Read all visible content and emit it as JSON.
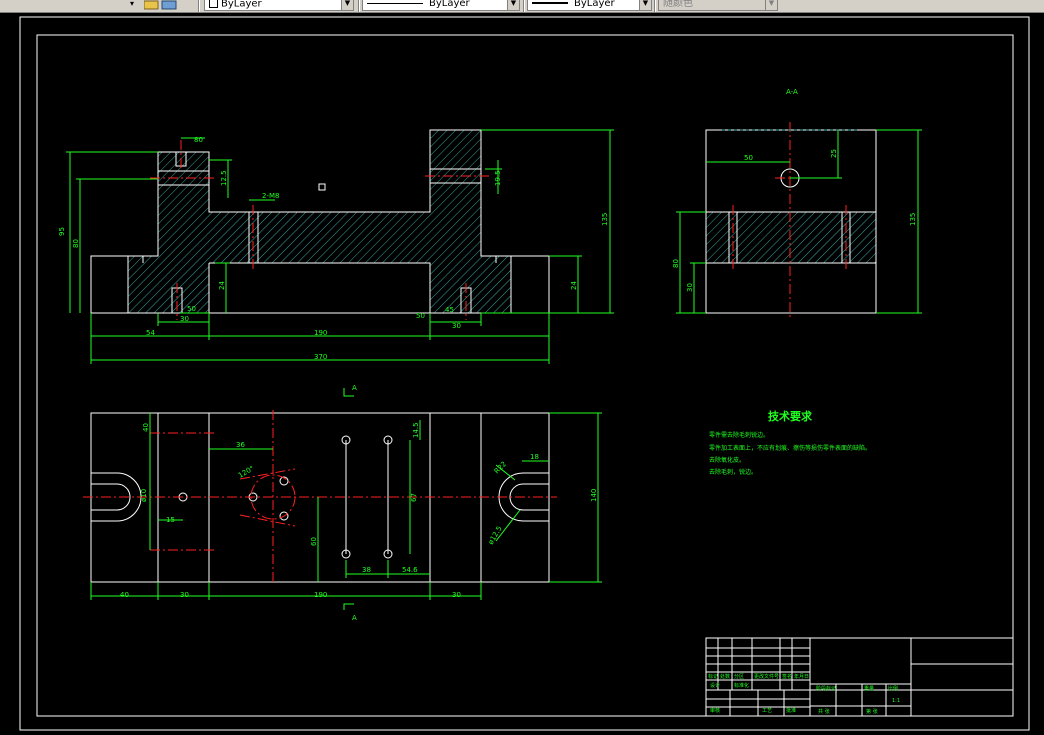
{
  "toolbar": {
    "layer_label": "ByLayer",
    "linetype_label": "ByLayer",
    "lineweight_label": "ByLayer",
    "color_label": "随颜色"
  },
  "drawing": {
    "section_label": "A-A",
    "arrow_label_top": "A",
    "arrow_label_bottom": "A",
    "tech_title": "技术要求",
    "tech_notes": [
      "零件需去除毛刺锐边。",
      "零件加工表面上，不应有划痕、擦伤等损伤零件表面的缺陷。",
      "去除氧化皮。",
      "去除毛刺，锐边。"
    ],
    "dims_front": {
      "overall_width": "370",
      "center_span": "190",
      "left_offset": "54",
      "step_left": "30",
      "step_right": "30",
      "slot_left": "50",
      "slot_right": "50",
      "height_total": "135",
      "height_left_a": "95",
      "height_left_b": "80",
      "base_h": "24",
      "step_h": "24",
      "slot_top": "80",
      "groove": "2-M8",
      "groove_top": "12.5",
      "right_h": "19.5",
      "small_h": "45"
    },
    "dims_side": {
      "top_w": "50",
      "top_h": "25",
      "height_total": "135",
      "mid_h": "80",
      "base_h": "30"
    },
    "dims_plan": {
      "bottom_left": "40",
      "bottom_a": "30",
      "bottom_center": "190",
      "bottom_b": "30",
      "overall_h": "140",
      "top_h": "14.5",
      "left_h": "40",
      "center_w": "36",
      "small_w": "15",
      "angle": "120°",
      "pitch_a": "38",
      "pitch_b": "54.6",
      "inner_h": "67",
      "radius_r": "R22",
      "slot_w": "18",
      "hole_dia": "ø10",
      "hole_dia2": "ø12.5",
      "center_h": "60"
    },
    "title_block": {
      "cells": [
        "标记",
        "处数",
        "分区",
        "更改文件号",
        "签名",
        "年月日",
        "设计",
        "标准化",
        "阶段标记",
        "重量",
        "比例",
        "审核",
        "工艺",
        "批准",
        "共 张",
        "第 张",
        "1:1"
      ]
    }
  }
}
